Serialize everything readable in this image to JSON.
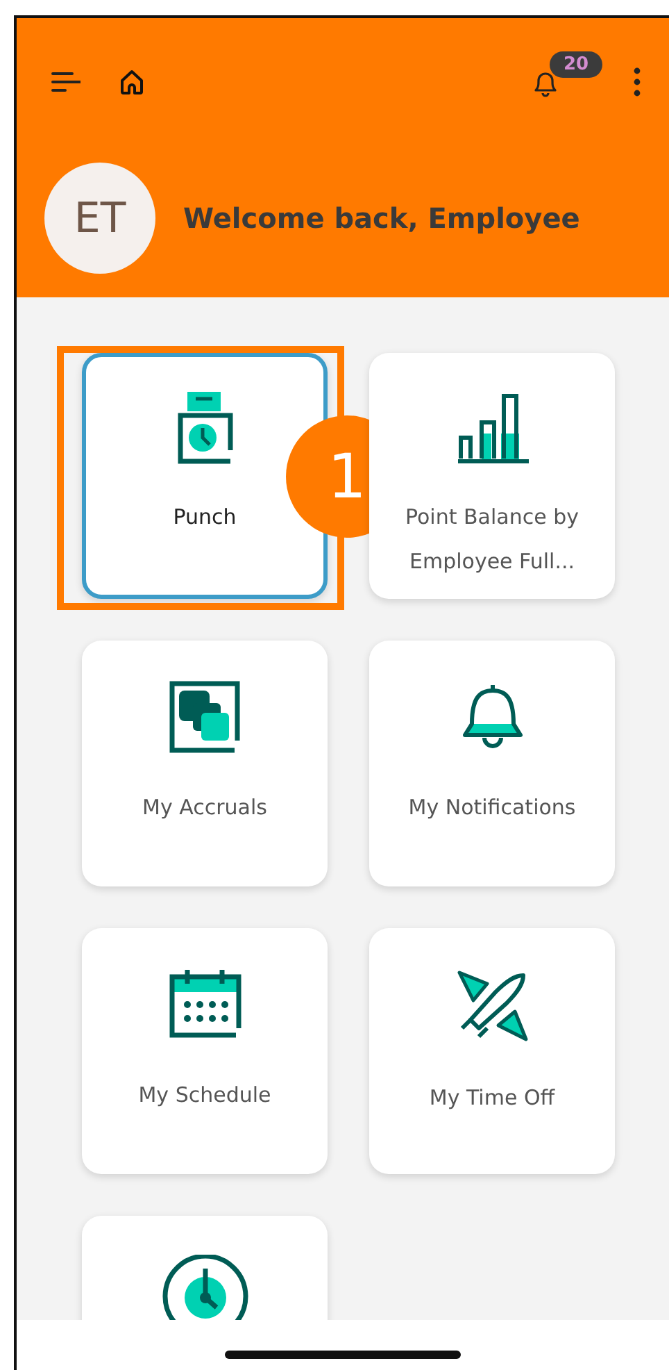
{
  "top_bar": {
    "notification_count": "20"
  },
  "header": {
    "avatar_initials": "ET",
    "welcome": "Welcome back, Employee"
  },
  "tiles": [
    {
      "kind": "punch",
      "label": "Punch",
      "selected": true
    },
    {
      "kind": "chart",
      "label": "Point Balance by Employee Full...",
      "selected": false
    },
    {
      "kind": "accruals",
      "label": "My Accruals",
      "selected": false
    },
    {
      "kind": "bell",
      "label": "My Notifications",
      "selected": false
    },
    {
      "kind": "calendar",
      "label": "My Schedule",
      "selected": false
    },
    {
      "kind": "plane",
      "label": "My Time Off",
      "selected": false
    },
    {
      "kind": "timer",
      "selected": false
    }
  ],
  "callout": {
    "number": "1"
  }
}
